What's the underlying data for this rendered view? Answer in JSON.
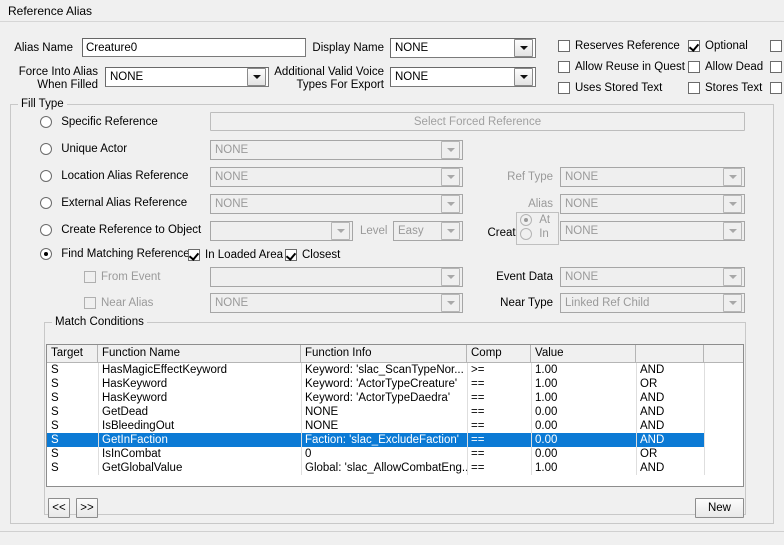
{
  "window": {
    "title": "Reference Alias"
  },
  "top": {
    "alias_name_label": "Alias Name",
    "alias_name_value": "Creature0",
    "display_name_label": "Display Name",
    "display_name_value": "NONE",
    "force_into_alias_label_1": "Force Into Alias",
    "force_into_alias_label_2": "When Filled",
    "force_into_alias_value": "NONE",
    "additional_voice_label_1": "Additional Valid Voice",
    "additional_voice_label_2": "Types For Export",
    "additional_voice_value": "NONE",
    "checkboxes": [
      {
        "label": "Reserves Reference",
        "checked": false
      },
      {
        "label": "Optional",
        "checked": true
      },
      {
        "label": "",
        "checked": false
      },
      {
        "label": "Allow Reuse in Quest",
        "checked": false
      },
      {
        "label": "Allow Dead",
        "checked": false
      },
      {
        "label": "",
        "checked": false
      },
      {
        "label": "Uses Stored Text",
        "checked": false
      },
      {
        "label": "Stores Text",
        "checked": false
      },
      {
        "label": "",
        "checked": false
      }
    ]
  },
  "fill_type": {
    "caption": "Fill Type",
    "options": [
      {
        "label": "Specific Reference",
        "selected": false
      },
      {
        "label": "Unique Actor",
        "selected": false
      },
      {
        "label": "Location Alias Reference",
        "selected": false
      },
      {
        "label": "External Alias Reference",
        "selected": false
      },
      {
        "label": "Create Reference to Object",
        "selected": false
      },
      {
        "label": "Find Matching Reference",
        "selected": true
      }
    ],
    "select_forced_reference_button": "Select Forced Reference",
    "unique_actor_value": "NONE",
    "location_alias_value": "NONE",
    "external_alias_value": "NONE",
    "create_ref_object_value": "",
    "level_label": "Level",
    "level_value": "Easy",
    "in_loaded_area": {
      "label": "In Loaded Area",
      "checked": true
    },
    "closest": {
      "label": "Closest",
      "checked": true
    },
    "from_event": {
      "label": "From Event",
      "checked": false,
      "value": ""
    },
    "near_alias": {
      "label": "Near Alias",
      "checked": false,
      "value": "NONE"
    },
    "ref_type_label": "Ref Type",
    "ref_type_value": "NONE",
    "alias_label": "Alias",
    "alias_value": "NONE",
    "create_label": "Create",
    "create_at_label": "At",
    "create_in_label": "In",
    "create_at_selected": true,
    "create_in_selected": false,
    "create_value": "NONE",
    "event_data_label": "Event Data",
    "event_data_value": "NONE",
    "near_type_label": "Near Type",
    "near_type_value": "Linked Ref Child"
  },
  "match_conditions": {
    "caption": "Match Conditions",
    "columns": [
      "Target",
      "Function Name",
      "Function Info",
      "Comp",
      "Value",
      "",
      ""
    ],
    "rows": [
      {
        "target": "S",
        "function_name": "HasMagicEffectKeyword",
        "function_info": "Keyword: 'slac_ScanTypeNor...",
        "comp": ">=",
        "value": "1.00",
        "logic": "AND",
        "extra": "",
        "selected": false
      },
      {
        "target": "S",
        "function_name": "HasKeyword",
        "function_info": "Keyword: 'ActorTypeCreature'",
        "comp": "==",
        "value": "1.00",
        "logic": "OR",
        "extra": "",
        "selected": false
      },
      {
        "target": "S",
        "function_name": "HasKeyword",
        "function_info": "Keyword: 'ActorTypeDaedra'",
        "comp": "==",
        "value": "1.00",
        "logic": "AND",
        "extra": "",
        "selected": false
      },
      {
        "target": "S",
        "function_name": "GetDead",
        "function_info": "NONE",
        "comp": "==",
        "value": "0.00",
        "logic": "AND",
        "extra": "",
        "selected": false
      },
      {
        "target": "S",
        "function_name": "IsBleedingOut",
        "function_info": "NONE",
        "comp": "==",
        "value": "0.00",
        "logic": "AND",
        "extra": "",
        "selected": false
      },
      {
        "target": "S",
        "function_name": "GetInFaction",
        "function_info": "Faction: 'slac_ExcludeFaction'",
        "comp": "==",
        "value": "0.00",
        "logic": "AND",
        "extra": "",
        "selected": true
      },
      {
        "target": "S",
        "function_name": "IsInCombat",
        "function_info": "0",
        "comp": "==",
        "value": "0.00",
        "logic": "OR",
        "extra": "",
        "selected": false
      },
      {
        "target": "S",
        "function_name": "GetGlobalValue",
        "function_info": "Global: 'slac_AllowCombatEng...",
        "comp": "==",
        "value": "1.00",
        "logic": "AND",
        "extra": "",
        "selected": false
      }
    ],
    "prev_button": "<<",
    "next_button": ">>",
    "new_button": "New"
  },
  "colors": {
    "selection": "#0b7ad5",
    "window_bg": "#f0f0f0",
    "field_bg": "#ffffff",
    "disabled_text": "#9a9a9a"
  }
}
